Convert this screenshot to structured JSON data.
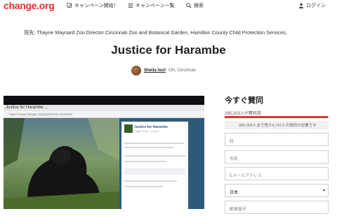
{
  "header": {
    "logo": "change.org",
    "start_label": "キャンペーン開始！",
    "browse_label": "キャンペーン一覧",
    "search_label": "検索",
    "login_label": "ログイン"
  },
  "petition": {
    "target": "宛先: Thayne Maynard Zoo Director Cincinnati Zoo and Botanical Garden, Hamilton County Child Protection Services,",
    "title": "Justice for Harambe",
    "author_name": "Sheila hurt",
    "author_location": "OH, Cincinnati"
  },
  "hero": {
    "tab_text": "Justice for Harambe ...",
    "url_text": "https://www.change.org/p/justice-for-harambe",
    "post_title": "Justice for Harambe",
    "post_subtitle": "Page Liked · 14 hrs"
  },
  "sign": {
    "heading": "今すぐ賛同",
    "count": "295,203人が賛同済",
    "progress": 0.98,
    "goal": "300,000人まで残り4,797人の賛同が必要です",
    "first_name_placeholder": "姓",
    "last_name_placeholder": "名前",
    "email_placeholder": "Eメールアドレス",
    "country_value": "日本",
    "postal_placeholder": "郵便番号"
  },
  "colors": {
    "brand_red": "#e3312f"
  }
}
